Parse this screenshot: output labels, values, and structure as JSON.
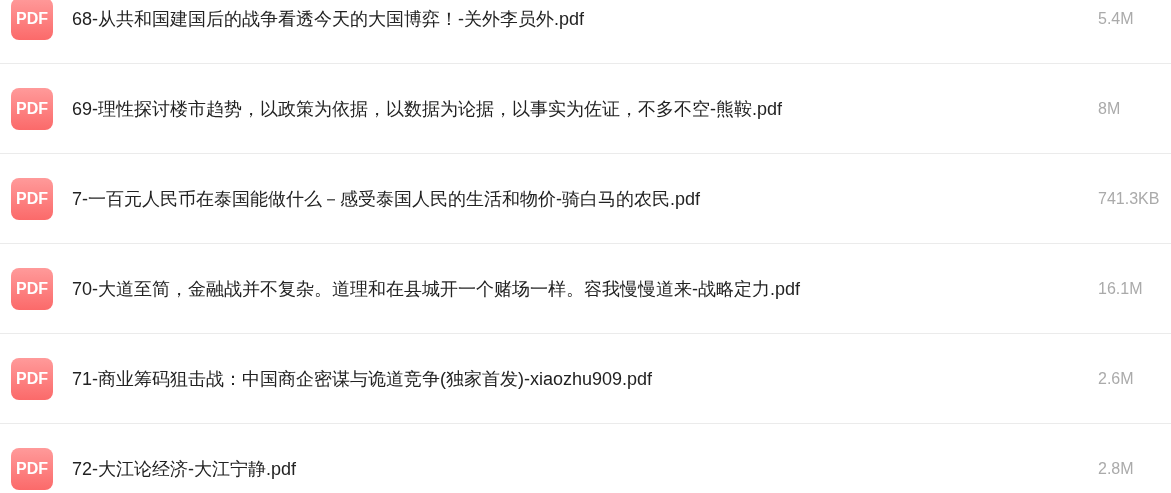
{
  "files": [
    {
      "name": "68-从共和国建国后的战争看透今天的大国博弈！-关外李员外.pdf",
      "size": "5.4M",
      "icon": "PDF"
    },
    {
      "name": "69-理性探讨楼市趋势，以政策为依据，以数据为论据，以事实为佐证，不多不空-熊鞍.pdf",
      "size": "8M",
      "icon": "PDF"
    },
    {
      "name": "7-一百元人民币在泰国能做什么－感受泰国人民的生活和物价-骑白马的农民.pdf",
      "size": "741.3KB",
      "icon": "PDF"
    },
    {
      "name": "70-大道至简，金融战并不复杂。道理和在县城开一个赌场一样。容我慢慢道来-战略定力.pdf",
      "size": "16.1M",
      "icon": "PDF"
    },
    {
      "name": "71-商业筹码狙击战：中国商企密谋与诡道竞争(独家首发)-xiaozhu909.pdf",
      "size": "2.6M",
      "icon": "PDF"
    },
    {
      "name": "72-大江论经济-大江宁静.pdf",
      "size": "2.8M",
      "icon": "PDF"
    }
  ]
}
